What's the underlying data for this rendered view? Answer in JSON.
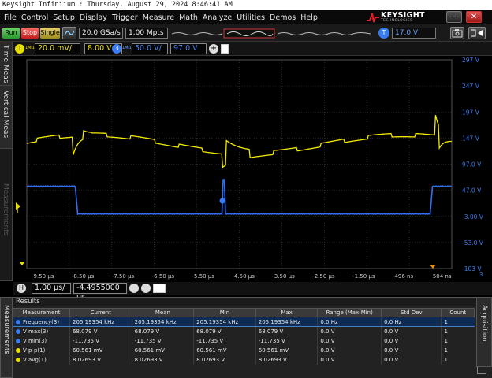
{
  "window": {
    "title": "Keysight Infiniium : Thursday, August 29, 2024 8:46:41 AM"
  },
  "menu": [
    "File",
    "Control",
    "Setup",
    "Display",
    "Trigger",
    "Measure",
    "Math",
    "Analyze",
    "Utilities",
    "Demos",
    "Help"
  ],
  "brand": {
    "name": "KEYSIGHT",
    "sub": "TECHNOLOGIES"
  },
  "window_controls": {
    "minimize": "–",
    "close": "✕"
  },
  "toolbar": {
    "run": "Run",
    "stop": "Stop",
    "single": "Single",
    "sample_rate": "20.0 GSa/s",
    "memory_depth": "1.00 Mpts",
    "trigger_badge": "T",
    "trigger_level": "17.0 V"
  },
  "channels": [
    {
      "num": "1",
      "coupling": "1MΩ",
      "scale": "20.0 mV/",
      "offset": "8.00 V",
      "color": "#e8e000"
    },
    {
      "num": "3",
      "coupling": "1MΩ",
      "scale": "50.0 V/",
      "offset": "97.0 V",
      "color": "#3a7bf0"
    }
  ],
  "side_tabs": [
    "Time Meas",
    "Vertical Meas",
    "Measurements"
  ],
  "right_axis": [
    "297 V",
    "247 V",
    "197 V",
    "147 V",
    "97.0 V",
    "47.0 V",
    "-3.00 V",
    "-53.0 V",
    "-103 V"
  ],
  "time_axis": [
    "-9.50 µs",
    "-8.50 µs",
    "-7.50 µs",
    "-6.50 µs",
    "-5.50 µs",
    "-4.50 µs",
    "-3.50 µs",
    "-2.50 µs",
    "-1.50 µs",
    "-496 ns",
    "504 ns"
  ],
  "ground_marker": "1",
  "axis_channel": "3",
  "horizontal": {
    "badge": "H",
    "scale": "1.00 µs/",
    "position": "-4.4955000 µs"
  },
  "results": {
    "title": "Results",
    "columns": [
      "Measurement",
      "Current",
      "Mean",
      "Min",
      "Max",
      "Range (Max-Min)",
      "Std Dev",
      "Count"
    ],
    "rows": [
      {
        "name": "Frequency(3)",
        "color": "#3a7bf0",
        "current": "205.19354 kHz",
        "mean": "205.19354 kHz",
        "min": "205.19354 kHz",
        "max": "205.19354 kHz",
        "range": "0.0 Hz",
        "std": "0.0 Hz",
        "count": "1"
      },
      {
        "name": "V max(3)",
        "color": "#3a7bf0",
        "current": "68.079 V",
        "mean": "68.079 V",
        "min": "68.079 V",
        "max": "68.079 V",
        "range": "0.0 V",
        "std": "0.0 V",
        "count": "1"
      },
      {
        "name": "V min(3)",
        "color": "#3a7bf0",
        "current": "-11.735 V",
        "mean": "-11.735 V",
        "min": "-11.735 V",
        "max": "-11.735 V",
        "range": "0.0 V",
        "std": "0.0 V",
        "count": "1"
      },
      {
        "name": "V p-p(1)",
        "color": "#e8e000",
        "current": "60.561 mV",
        "mean": "60.561 mV",
        "min": "60.561 mV",
        "max": "60.561 mV",
        "range": "0.0 V",
        "std": "0.0 V",
        "count": "1"
      },
      {
        "name": "V avg(1)",
        "color": "#e8e000",
        "current": "8.02693 V",
        "mean": "8.02693 V",
        "min": "8.02693 V",
        "max": "8.02693 V",
        "range": "0.0 V",
        "std": "0.0 V",
        "count": "1"
      }
    ]
  },
  "right_tab": "Acquisition"
}
